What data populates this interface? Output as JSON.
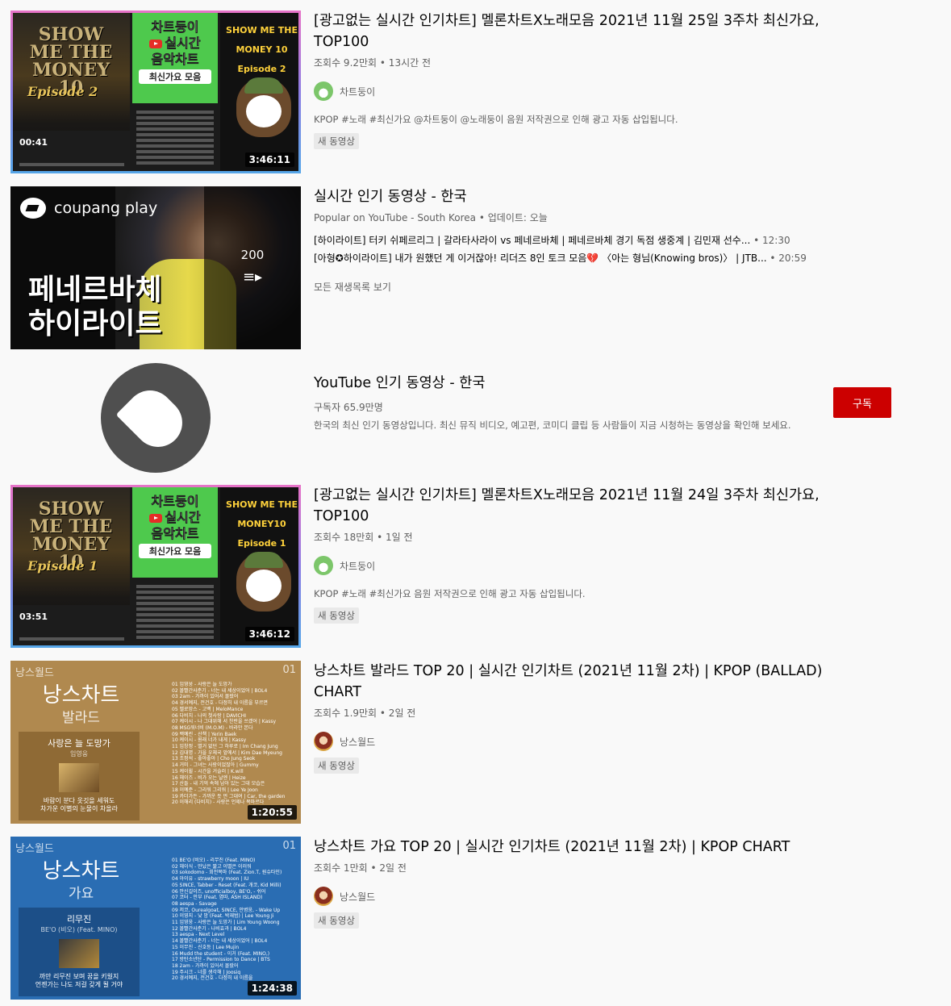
{
  "videos": [
    {
      "title": "[광고없는 실시간 인기차트] 멜론차트X노래모음 2021년 11월 25일 3주차 최신가요, TOP100",
      "meta": "조회수 9.2만회 • 13시간 전",
      "channel": "차트둥이",
      "description": "KPOP #노래 #최신가요 @차트둥이 @노래둥이 음원 저작권으로 인해 광고 자동 삽입됩니다.",
      "badge": "새 동영상",
      "duration": "3:46:11",
      "thumb": {
        "left_title": "SHOW ME THE MONEY 10",
        "left_episode": "Episode 2",
        "player_time": "00:41",
        "box_line1": "차트둥이",
        "box_line2": "실시간",
        "box_line3": "음악차트",
        "box_line4": "최신가요 모음",
        "right_title": "SHOW ME THE MONEY 10",
        "right_episode": "Episode 2"
      }
    },
    {
      "title": "[광고없는 실시간 인기차트] 멜론차트X노래모음 2021년 11월 24일 3주차 최신가요, TOP100",
      "meta": "조회수 18만회 • 1일 전",
      "channel": "차트둥이",
      "description": "KPOP #노래 #최신가요 음원 저작권으로 인해 광고 자동 삽입됩니다.",
      "badge": "새 동영상",
      "duration": "3:46:12",
      "thumb": {
        "left_title": "SHOW ME THE MONEY 10",
        "left_episode": "Episode 1",
        "player_time": "03:51",
        "box_line1": "차트둥이",
        "box_line2": "실시간",
        "box_line3": "음악차트",
        "box_line4": "최신가요 모음",
        "right_title": "SHOW ME THE MONEY10",
        "right_episode": "Episode 1"
      }
    },
    {
      "title": "낭스차트 발라드 TOP 20 | 실시간 인기차트 (2021년 11월 2차) | KPOP (BALLAD) CHART",
      "meta": "조회수 1.9만회 • 2일 전",
      "channel": "낭스월드",
      "badge": "새 동영상",
      "duration": "1:20:55",
      "thumb": {
        "brand": "낭스월드",
        "num": "01",
        "big": "낭스차트",
        "genre": "발라드",
        "card_title": "사랑은 늘 도망가",
        "card_sub": "임영웅",
        "card_lyric1": "바람이 분다 옷깃을 세워도",
        "card_lyric2": "차가운 이별의 눈물이 차올라",
        "tracks": [
          "01 임영웅 - 사랑은 늘 도망가",
          "02 볼빨간사춘기 - 너는 내 세상이었어 | BOL4",
          "03 2am - 가까이 있어서 몰랐어",
          "04 경서예지, 전건호 - 다정히 내 이름을 부르면",
          "05 멜로망스 - 고백 | MeloMance",
          "06 다비치 - 나의 첫사랑 | DAVICHI",
          "07 케이시 - 나 그대위해 서 찬란을 쓰겠어 | Kassy",
          "08 MSG워너비 (M.O.M) - 바라만 본다",
          "09 백예린 - 산책 | Yerin Baek",
          "10 케이시 - 원래 너가 내게 | Kassy",
          "11 임창정 - 별거 없던 그 하루로 | Im Chang Jung",
          "12 김대명 - 가을 우체국 앞에서 | Kim Dae Myeung",
          "13 조정석 - 좋아좋아 | Cho Jung Seok",
          "14 거미 - 그녀는 사랑이었잖아 | Gummy",
          "15 케이윌 - 시간을 거슬러 | K.will",
          "16 헤이즈 - 비가 오는 날엔 | Heize",
          "17 산들 - 내 기억 속에 남아 있는 그대 모습은",
          "18 이예준 - 그리워 그리워 | Lee Ye Joon",
          "19 카더가든 - 가까운 듯 먼 그대여 | Car, the garden",
          "20 이해리 (다비치) - 사랑은 언제나 목마르다"
        ]
      }
    },
    {
      "title": "낭스차트 가요 TOP 20 | 실시간 인기차트 (2021년 11월 2차) | KPOP CHART",
      "meta": "조회수 1만회 • 2일 전",
      "channel": "낭스월드",
      "badge": "새 동영상",
      "duration": "1:24:38",
      "thumb": {
        "brand": "낭스월드",
        "num": "01",
        "big": "낭스차트",
        "genre": "가요",
        "card_title": "리무진",
        "card_sub": "BE'O (비오) (Feat. MINO)",
        "card_lyric1": "까만 리무진 보며 꿈을 키웠지",
        "card_lyric2": "언젠가는 나도 저걸 갖게 될 거야",
        "tracks": [
          "01 BE'O (비오) - 리무진 (Feat. MINO)",
          "02 헤이식 - 만났은 짧고 이별은 이러워",
          "03 sokodomo - 회전목마 (Feat. Zion.T, 원슈타인)",
          "04 아이유 - strawberry moon | IU",
          "05 SINCE, Tabber - Reset (Feat. 개코, Kid Milli)",
          "06 안신길이즈, unofficialboy, BE'O, - 쉬어",
          "07 코터 - 안부 (Feat. 염따, ASH ISLAND)",
          "08 aespa - Savage",
          "09 저코, Ourealgoat, SINCE, 안병웅, - Wake Up",
          "10 이영지 - 낮 밤 (Feat. 박재범) | Lee Young Ji",
          "11 임영웅 - 사랑은 늘 도망가 | Lim Young Woong",
          "12 볼빨간사춘기 - 나비효과 | BOL4",
          "13 aespa - Next Level",
          "14 볼빨간사춘기 - 너는 내 세상이었어 | BOL4",
          "15 이무진 - 신호등 | Lee Mujin",
          "16 Mudd the student - 이거 (Feat. MINO,)",
          "17 방탄소년단 - Permission to Dance | BTS",
          "18 2am - 가까이 있어서 몰랐어",
          "19 주시크 - 너를 생각해 | Joosiq",
          "20 경서예지, 전건호 - 다정히 내 이름을"
        ]
      }
    }
  ],
  "playlist": {
    "title": "실시간 인기 동영상 - 한국",
    "meta": "Popular on YouTube - South Korea • 업데이트: 오늘",
    "items": [
      {
        "text": "[하이라이트] 터키 쉬페르리그 | 갈라타사라이 vs 페네르바체 | 페네르바체 경기 독점 생중계 | 김민재 선수...",
        "dur": " • 12:30"
      },
      {
        "text": "[아형✪하이라이트] 내가 원했던 게 이거잖아! 리더즈 8인 토크 모음💔 〈아는 형님(Knowing bros)〉 | JTB...",
        "dur": " • 20:59"
      }
    ],
    "view_all": "모든 재생목록 보기",
    "count": "200",
    "thumb_logo": "coupang play",
    "thumb_line1": "페네르바체",
    "thumb_line2": "하이라이트"
  },
  "channel_result": {
    "title": "YouTube 인기 동영상 - 한국",
    "subscribers": "구독자 65.9만명",
    "description": "한국의 최신 인기 동영상입니다. 최신 뮤직 비디오, 예고편, 코미디 클립 등 사람들이 지금 시청하는 동영상을 확인해 보세요.",
    "subscribe_label": "구독"
  },
  "colors": {
    "subscribe": "#cc0000",
    "nang_ballad": "#b0894f",
    "nang_kpop": "#2a6db3",
    "chart_green": "#4ec94d"
  }
}
